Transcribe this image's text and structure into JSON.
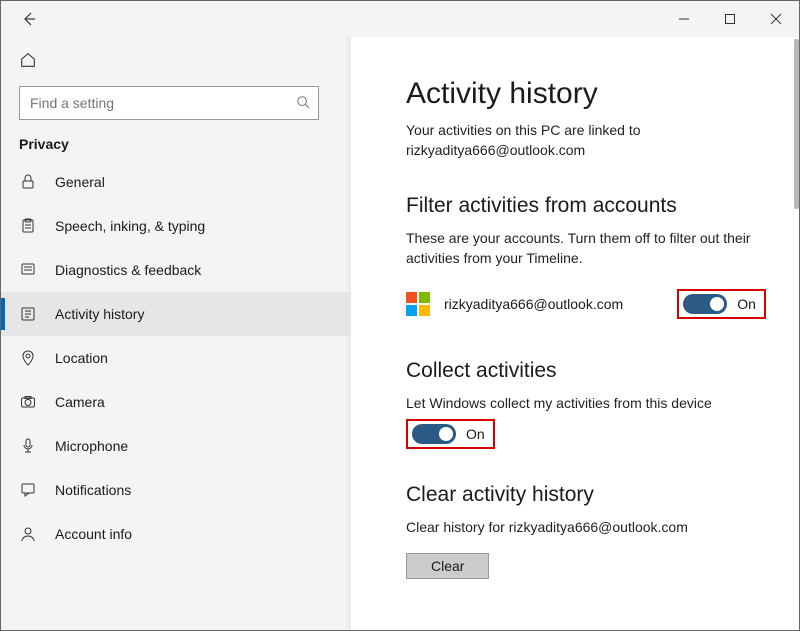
{
  "titlebar": {
    "back_icon": "back-arrow"
  },
  "sidebar": {
    "search_placeholder": "Find a setting",
    "section": "Privacy",
    "items": [
      {
        "icon": "lock",
        "label": "General"
      },
      {
        "icon": "clipboard",
        "label": "Speech, inking, & typing"
      },
      {
        "icon": "note-grid",
        "label": "Diagnostics & feedback"
      },
      {
        "icon": "history",
        "label": "Activity history",
        "active": true
      },
      {
        "icon": "pin",
        "label": "Location"
      },
      {
        "icon": "camera",
        "label": "Camera"
      },
      {
        "icon": "mic",
        "label": "Microphone"
      },
      {
        "icon": "bubble",
        "label": "Notifications"
      },
      {
        "icon": "person",
        "label": "Account info"
      }
    ]
  },
  "main": {
    "title": "Activity history",
    "subtitle_line1": "Your activities on this PC are linked to",
    "subtitle_line2": "rizkyaditya666@outlook.com",
    "filter_heading": "Filter activities from accounts",
    "filter_desc": "These are your accounts. Turn them off to filter out their activities from your Timeline.",
    "account_email": "rizkyaditya666@outlook.com",
    "filter_toggle_label": "On",
    "collect_heading": "Collect activities",
    "collect_desc": "Let Windows collect my activities from this device",
    "collect_toggle_label": "On",
    "clear_heading": "Clear activity history",
    "clear_desc": "Clear history for rizkyaditya666@outlook.com",
    "clear_button": "Clear"
  }
}
